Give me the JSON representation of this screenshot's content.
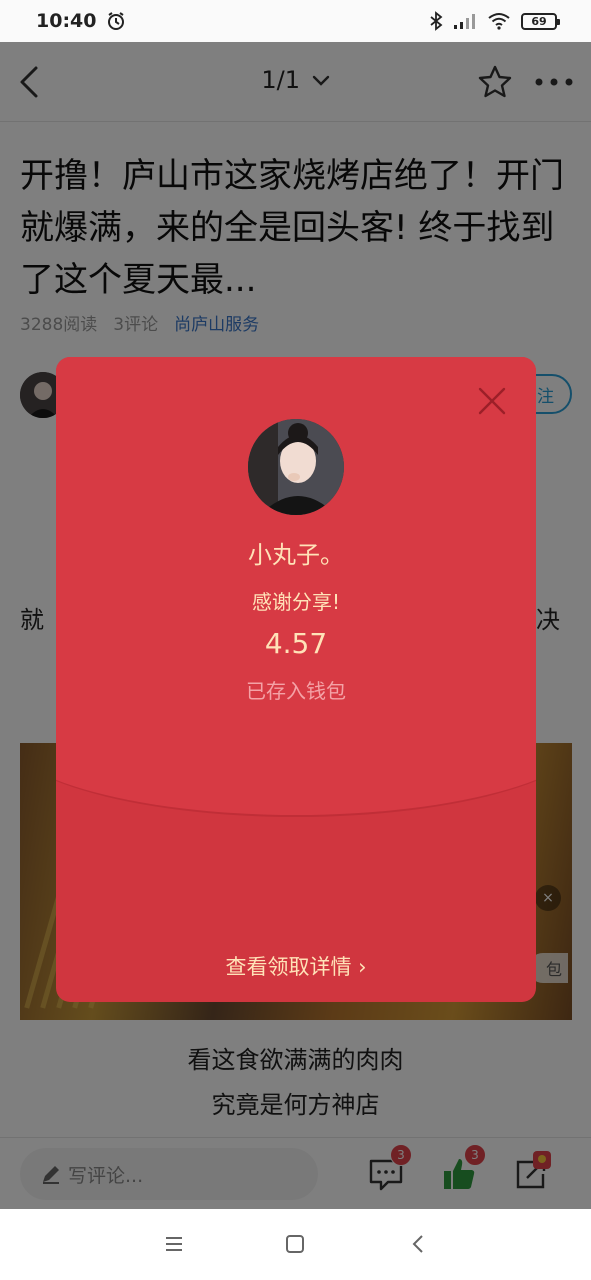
{
  "status_bar": {
    "time": "10:40",
    "battery": "69"
  },
  "header": {
    "page_indicator": "1/1"
  },
  "article": {
    "title": "开撸！庐山市这家烧烤店绝了！开门就爆满，来的全是回头客! 终于找到了这个夏天最...",
    "reads": "3288阅读",
    "comments": "3评论",
    "source": "尚庐山服务",
    "follow_label": "注",
    "body_left_fragment": "就",
    "body_right_fragment": "决",
    "ad_close": "×",
    "ad_tag": "包",
    "caption_line1": "看这食欲满满的肉肉",
    "caption_line2": "究竟是何方神店"
  },
  "bottom_bar": {
    "comment_placeholder": "写评论...",
    "comment_count": "3",
    "like_count": "3"
  },
  "red_envelope": {
    "sender_name": "小丸子。",
    "message": "感谢分享!",
    "amount": "4.57",
    "status": "已存入钱包",
    "details_link": "查看领取详情 ›"
  },
  "colors": {
    "envelope_red": "#d0363f",
    "envelope_gold_text": "#ffe2b8",
    "link_blue": "#3a76c8",
    "follow_blue": "#2a9fd6",
    "badge_red": "#e0434b",
    "like_green": "#2e9a3e"
  }
}
